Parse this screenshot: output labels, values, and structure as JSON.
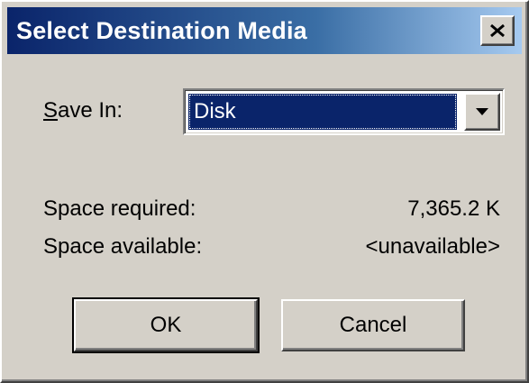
{
  "dialog": {
    "title": "Select Destination Media",
    "close_icon": "close-icon"
  },
  "save_in": {
    "label_first_char": "S",
    "label_rest": "ave In:",
    "selected_value": "Disk",
    "dropdown_icon": "chevron-down-icon"
  },
  "info": {
    "space_required_label": "Space required:",
    "space_required_value": "7,365.2 K",
    "space_available_label": "Space available:",
    "space_available_value": "<unavailable>"
  },
  "buttons": {
    "ok_label": "OK",
    "cancel_label": "Cancel"
  },
  "colors": {
    "title_bar_start": "#0a246a",
    "title_bar_end": "#a6caf0",
    "face": "#d4d0c8",
    "selection": "#0a246a"
  }
}
